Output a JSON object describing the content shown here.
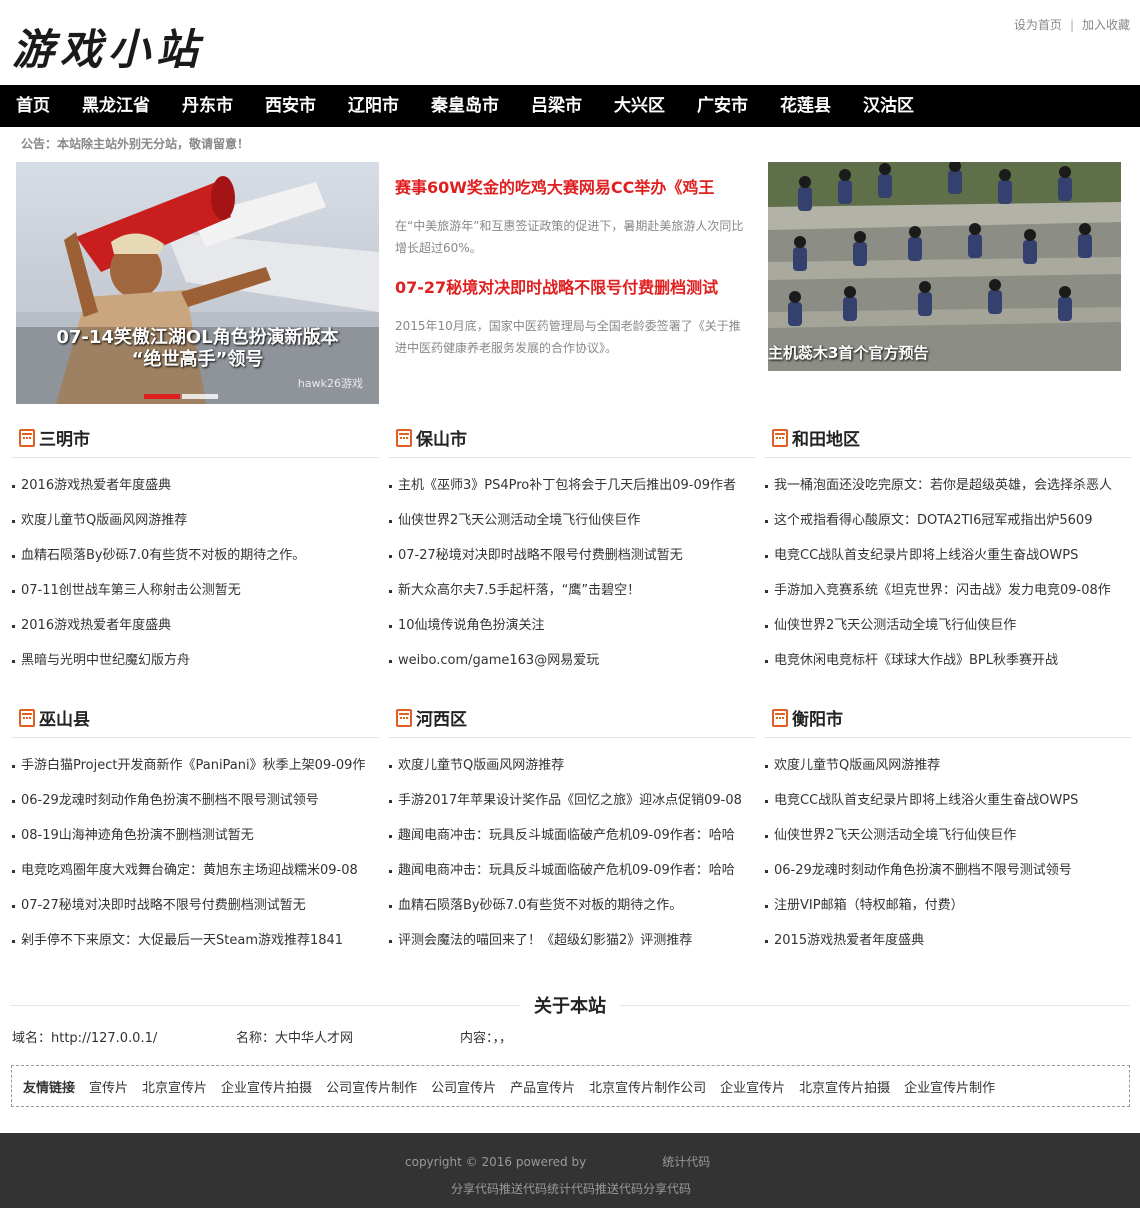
{
  "header": {
    "logo": "游戏小站",
    "set_home": "设为首页",
    "separator": "|",
    "add_favorite": "加入收藏"
  },
  "nav": [
    "首页",
    "黑龙江省",
    "丹东市",
    "西安市",
    "辽阳市",
    "秦皇岛市",
    "吕梁市",
    "大兴区",
    "广安市",
    "花莲县",
    "汉沽区"
  ],
  "notice": "公告：本站除主站外别无分站，敬请留意！",
  "slider": {
    "caption_line1": "07-14笑傲江湖OL角色扮演新版本",
    "caption_line2": "“绝世高手”领号",
    "watermark": "hawk26游戏",
    "slide_count": 2,
    "active_slide": 1
  },
  "headlines": [
    {
      "title": "赛事60W奖金的吃鸡大赛网易CC举办《鸡王",
      "desc": "在“中美旅游年”和互惠签证政策的促进下，暑期赴美旅游人次同比增长超过60%。"
    },
    {
      "title": "07-27秘境对决即时战略不限号付费删档测试",
      "desc": "2015年10月底，国家中医药管理局与全国老龄委签署了《关于推进中医药健康养老服务发展的合作协议》。"
    }
  ],
  "right_pic": {
    "caption": "主机蕊木3首个官方预告"
  },
  "sections": [
    {
      "name": "三明市",
      "items": [
        "2016游戏热爱者年度盛典",
        "欢度儿童节Q版画风网游推荐",
        "血精石陨落By砂砾7.0有些货不对板的期待之作。",
        "07-11创世战车第三人称射击公测暂无",
        "2016游戏热爱者年度盛典",
        "黑暗与光明中世纪魔幻版方舟"
      ]
    },
    {
      "name": "保山市",
      "items": [
        "主机《巫师3》PS4Pro补丁包将会于几天后推出09-09作者",
        "仙侠世界2飞天公测活动全境飞行仙侠巨作",
        "07-27秘境对决即时战略不限号付费删档测试暂无",
        "新大众高尔夫7.5手起杆落，“鹰”击碧空！",
        "10仙境传说角色扮演关注",
        "weibo.com/game163@网易爱玩"
      ]
    },
    {
      "name": "和田地区",
      "items": [
        "我一桶泡面还没吃完原文：若你是超级英雄，会选择杀恶人",
        "这个戒指看得心酸原文：DOTA2TI6冠军戒指出炉5609",
        "电竞CC战队首支纪录片即将上线浴火重生奋战OWPS",
        "手游加入竞赛系统《坦克世界：闪击战》发力电竞09-08作",
        "仙侠世界2飞天公测活动全境飞行仙侠巨作",
        "电竞休闲电竞标杆《球球大作战》BPL秋季赛开战"
      ]
    },
    {
      "name": "巫山县",
      "items": [
        "手游白猫Project开发商新作《PaniPani》秋季上架09-09作",
        "06-29龙魂时刻动作角色扮演不删档不限号测试领号",
        "08-19山海神迹角色扮演不删档测试暂无",
        "电竞吃鸡圈年度大戏舞台确定：黄旭东主场迎战糯米09-08",
        "07-27秘境对决即时战略不限号付费删档测试暂无",
        "剁手停不下来原文：大促最后一天Steam游戏推荐1841"
      ]
    },
    {
      "name": "河西区",
      "items": [
        "欢度儿童节Q版画风网游推荐",
        "手游2017年苹果设计奖作品《回忆之旅》迎冰点促销09-08",
        "趣闻电商冲击：玩具反斗城面临破产危机09-09作者：哈哈",
        "趣闻电商冲击：玩具反斗城面临破产危机09-09作者：哈哈",
        "血精石陨落By砂砾7.0有些货不对板的期待之作。",
        "评测会魔法的喵回来了！《超级幻影猫2》评测推荐"
      ]
    },
    {
      "name": "衡阳市",
      "items": [
        "欢度儿童节Q版画风网游推荐",
        "电竞CC战队首支纪录片即将上线浴火重生奋战OWPS",
        "仙侠世界2飞天公测活动全境飞行仙侠巨作",
        "06-29龙魂时刻动作角色扮演不删档不限号测试领号",
        "注册VIP邮箱（特权邮箱，付费）",
        "2015游戏热爱者年度盛典"
      ]
    }
  ],
  "about": {
    "title": "关于本站",
    "domain": "域名：http://127.0.0.1/",
    "name": "名称：大中华人才网",
    "content": "内容：，，"
  },
  "friend_links": {
    "label": "友情链接",
    "items": [
      "宣传片",
      "北京宣传片",
      "企业宣传片拍摄",
      "公司宣传片制作",
      "公司宣传片",
      "产品宣传片",
      "北京宣传片制作公司",
      "企业宣传片",
      "北京宣传片拍摄",
      "企业宣传片制作"
    ]
  },
  "footer": {
    "copyright": "copyright © 2016 powered by",
    "stat": "统计代码",
    "line2": "分享代码推送代码统计代码推送代码分享代码"
  }
}
